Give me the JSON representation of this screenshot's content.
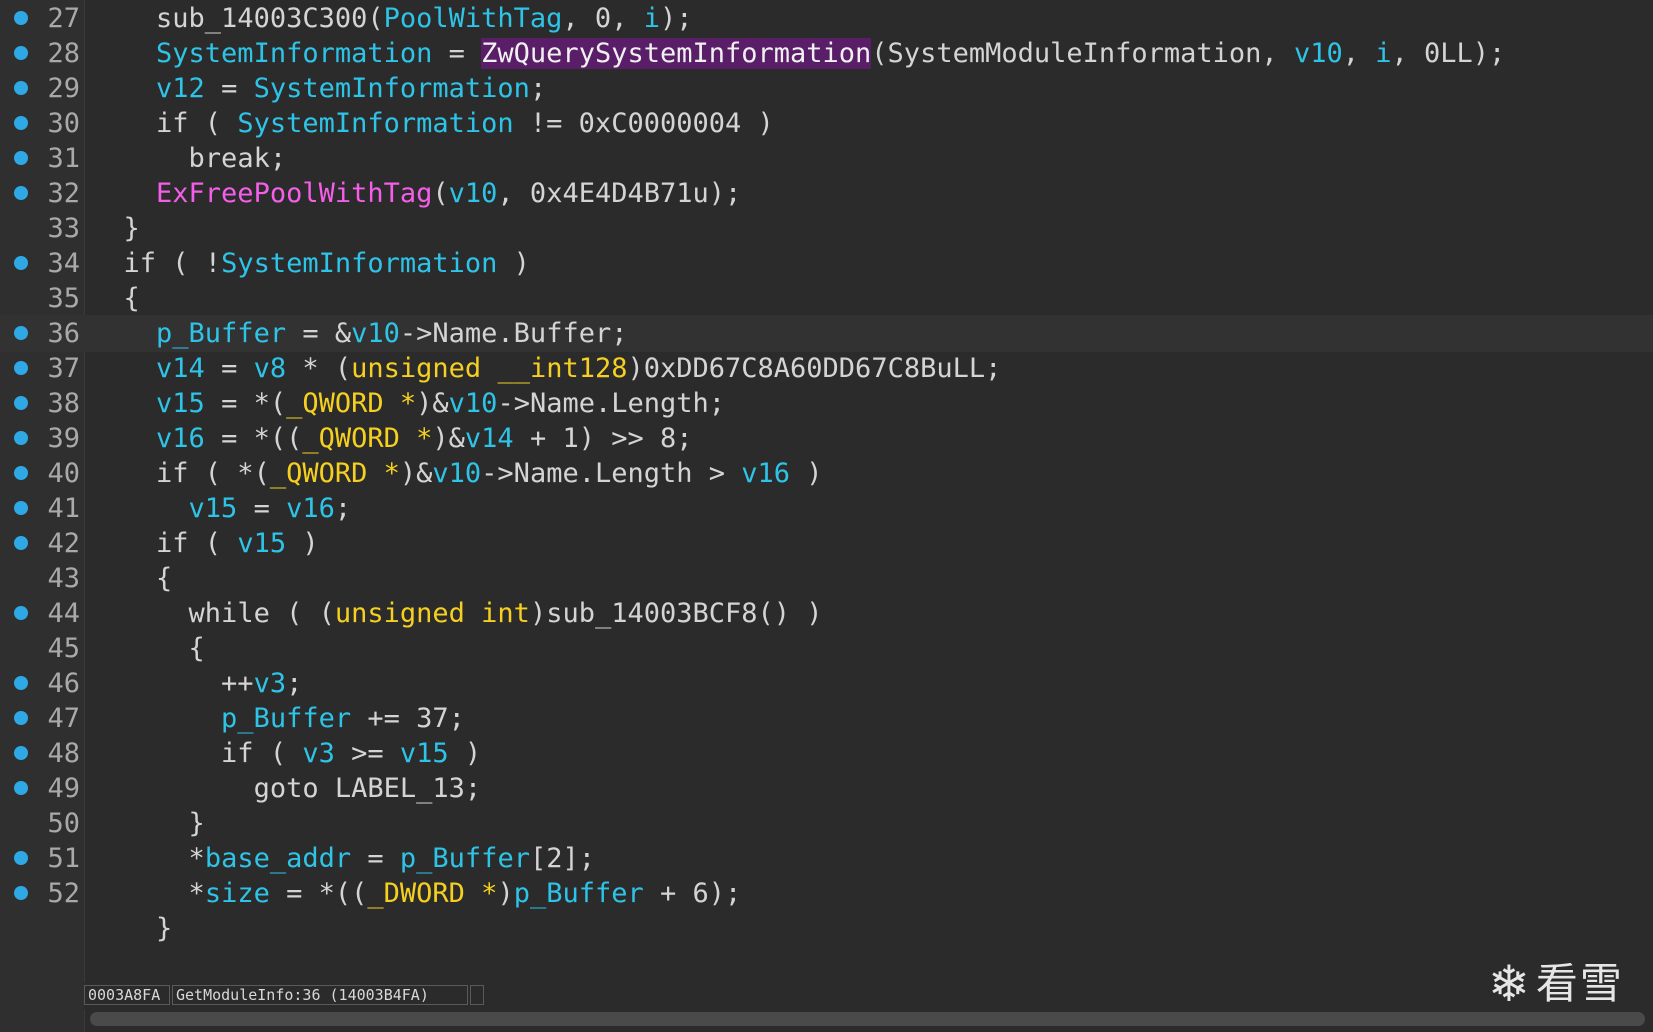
{
  "status": {
    "address": "0003A8FA",
    "location": "GetModuleInfo:36 (14003B4FA)",
    "extra": ""
  },
  "watermark": {
    "text": "看雪",
    "icon": "snowflake-icon"
  },
  "colors": {
    "background": "#2b2b2b",
    "identifier": "#2ec4e8",
    "type": "#f5d020",
    "function": "#f45ee8",
    "highlight": "#5a1e68",
    "breakpoint": "#2fa8e6"
  },
  "lines": [
    {
      "n": "27",
      "bp": true,
      "indent": "    ",
      "tokens": [
        [
          "p",
          "sub_14003C300("
        ],
        [
          "v",
          "PoolWithTag"
        ],
        [
          "p",
          ", 0, "
        ],
        [
          "v",
          "i"
        ],
        [
          "p",
          ");"
        ]
      ]
    },
    {
      "n": "28",
      "bp": true,
      "indent": "    ",
      "tokens": [
        [
          "v",
          "SystemInformation"
        ],
        [
          "p",
          " = "
        ],
        [
          "h",
          "ZwQuerySystemInformation"
        ],
        [
          "p",
          "(SystemModuleInformation, "
        ],
        [
          "v",
          "v10"
        ],
        [
          "p",
          ", "
        ],
        [
          "v",
          "i"
        ],
        [
          "p",
          ", 0LL);"
        ]
      ]
    },
    {
      "n": "29",
      "bp": true,
      "indent": "    ",
      "tokens": [
        [
          "v",
          "v12"
        ],
        [
          "p",
          " = "
        ],
        [
          "v",
          "SystemInformation"
        ],
        [
          "p",
          ";"
        ]
      ]
    },
    {
      "n": "30",
      "bp": true,
      "indent": "    ",
      "tokens": [
        [
          "p",
          "if ( "
        ],
        [
          "v",
          "SystemInformation"
        ],
        [
          "p",
          " != 0xC0000004 )"
        ]
      ]
    },
    {
      "n": "31",
      "bp": true,
      "indent": "      ",
      "tokens": [
        [
          "p",
          "break;"
        ]
      ]
    },
    {
      "n": "32",
      "bp": true,
      "indent": "    ",
      "tokens": [
        [
          "f",
          "ExFreePoolWithTag"
        ],
        [
          "p",
          "("
        ],
        [
          "v",
          "v10"
        ],
        [
          "p",
          ", 0x4E4D4B71u);"
        ]
      ]
    },
    {
      "n": "33",
      "bp": false,
      "indent": "  ",
      "tokens": [
        [
          "p",
          "}"
        ]
      ]
    },
    {
      "n": "34",
      "bp": true,
      "indent": "  ",
      "tokens": [
        [
          "p",
          "if ( !"
        ],
        [
          "v",
          "SystemInformation"
        ],
        [
          "p",
          " )"
        ]
      ]
    },
    {
      "n": "35",
      "bp": false,
      "indent": "  ",
      "tokens": [
        [
          "p",
          "{"
        ]
      ]
    },
    {
      "n": "36",
      "bp": true,
      "indent": "    ",
      "cur": true,
      "tokens": [
        [
          "v",
          "p_Buffer"
        ],
        [
          "p",
          " = &"
        ],
        [
          "v",
          "v10"
        ],
        [
          "p",
          "->Name.Buffer;"
        ]
      ]
    },
    {
      "n": "37",
      "bp": true,
      "indent": "    ",
      "tokens": [
        [
          "v",
          "v14"
        ],
        [
          "p",
          " = "
        ],
        [
          "v",
          "v8"
        ],
        [
          "p",
          " * ("
        ],
        [
          "t",
          "unsigned __int128"
        ],
        [
          "p",
          ")0xDD67C8A60DD67C8BuLL;"
        ]
      ]
    },
    {
      "n": "38",
      "bp": true,
      "indent": "    ",
      "tokens": [
        [
          "v",
          "v15"
        ],
        [
          "p",
          " = *("
        ],
        [
          "t",
          "_QWORD *"
        ],
        [
          "p",
          ")&"
        ],
        [
          "v",
          "v10"
        ],
        [
          "p",
          "->Name.Length;"
        ]
      ]
    },
    {
      "n": "39",
      "bp": true,
      "indent": "    ",
      "tokens": [
        [
          "v",
          "v16"
        ],
        [
          "p",
          " = *(("
        ],
        [
          "t",
          "_QWORD *"
        ],
        [
          "p",
          ")&"
        ],
        [
          "v",
          "v14"
        ],
        [
          "p",
          " + 1) >> 8;"
        ]
      ]
    },
    {
      "n": "40",
      "bp": true,
      "indent": "    ",
      "tokens": [
        [
          "p",
          "if ( *("
        ],
        [
          "t",
          "_QWORD *"
        ],
        [
          "p",
          ")&"
        ],
        [
          "v",
          "v10"
        ],
        [
          "p",
          "->Name.Length > "
        ],
        [
          "v",
          "v16"
        ],
        [
          "p",
          " )"
        ]
      ]
    },
    {
      "n": "41",
      "bp": true,
      "indent": "      ",
      "tokens": [
        [
          "v",
          "v15"
        ],
        [
          "p",
          " = "
        ],
        [
          "v",
          "v16"
        ],
        [
          "p",
          ";"
        ]
      ]
    },
    {
      "n": "42",
      "bp": true,
      "indent": "    ",
      "tokens": [
        [
          "p",
          "if ( "
        ],
        [
          "v",
          "v15"
        ],
        [
          "p",
          " )"
        ]
      ]
    },
    {
      "n": "43",
      "bp": false,
      "indent": "    ",
      "tokens": [
        [
          "p",
          "{"
        ]
      ]
    },
    {
      "n": "44",
      "bp": true,
      "indent": "      ",
      "tokens": [
        [
          "p",
          "while ( ("
        ],
        [
          "t",
          "unsigned int"
        ],
        [
          "p",
          ")sub_14003BCF8() )"
        ]
      ]
    },
    {
      "n": "45",
      "bp": false,
      "indent": "      ",
      "tokens": [
        [
          "p",
          "{"
        ]
      ]
    },
    {
      "n": "46",
      "bp": true,
      "indent": "        ",
      "tokens": [
        [
          "p",
          "++"
        ],
        [
          "v",
          "v3"
        ],
        [
          "p",
          ";"
        ]
      ]
    },
    {
      "n": "47",
      "bp": true,
      "indent": "        ",
      "tokens": [
        [
          "v",
          "p_Buffer"
        ],
        [
          "p",
          " += 37;"
        ]
      ]
    },
    {
      "n": "48",
      "bp": true,
      "indent": "        ",
      "tokens": [
        [
          "p",
          "if ( "
        ],
        [
          "v",
          "v3"
        ],
        [
          "p",
          " >= "
        ],
        [
          "v",
          "v15"
        ],
        [
          "p",
          " )"
        ]
      ]
    },
    {
      "n": "49",
      "bp": true,
      "indent": "          ",
      "tokens": [
        [
          "p",
          "goto LABEL_13;"
        ]
      ]
    },
    {
      "n": "50",
      "bp": false,
      "indent": "      ",
      "tokens": [
        [
          "p",
          "}"
        ]
      ]
    },
    {
      "n": "51",
      "bp": true,
      "indent": "      ",
      "tokens": [
        [
          "p",
          "*"
        ],
        [
          "v",
          "base_addr"
        ],
        [
          "p",
          " = "
        ],
        [
          "v",
          "p_Buffer"
        ],
        [
          "p",
          "[2];"
        ]
      ]
    },
    {
      "n": "52",
      "bp": true,
      "indent": "      ",
      "tokens": [
        [
          "p",
          "*"
        ],
        [
          "v",
          "size"
        ],
        [
          "p",
          " = *(("
        ],
        [
          "t",
          "_DWORD *"
        ],
        [
          "p",
          ")"
        ],
        [
          "v",
          "p_Buffer"
        ],
        [
          "p",
          " + 6);"
        ]
      ]
    },
    {
      "n": "",
      "bp": false,
      "indent": "    ",
      "tokens": [
        [
          "p",
          "}"
        ]
      ]
    }
  ]
}
